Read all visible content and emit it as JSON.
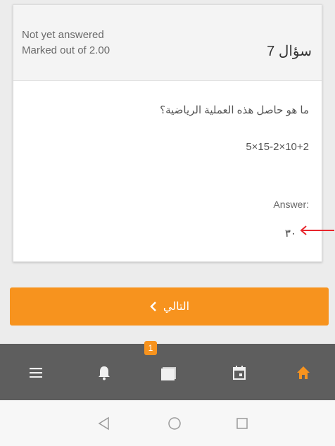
{
  "question": {
    "status": "Not yet answered",
    "marks": "Marked out of 2.00",
    "title": "سؤال 7",
    "text": "ما هو حاصل هذه العملية الرياضية؟",
    "expression": "5×15-2×10+2",
    "answer_label": ":Answer",
    "answer_value": "٣٠"
  },
  "actions": {
    "next_label": "التالي"
  },
  "bottom_nav": {
    "badge_count": "1",
    "icons": [
      "menu-icon",
      "bell-icon",
      "messages-icon",
      "calendar-icon",
      "home-icon"
    ]
  },
  "system_nav": {
    "icons": [
      "back-icon",
      "home-circle-icon",
      "recents-icon"
    ]
  },
  "colors": {
    "accent": "#f7931e",
    "nav_bg": "#5e5e5e",
    "arrow": "#e8262d"
  }
}
